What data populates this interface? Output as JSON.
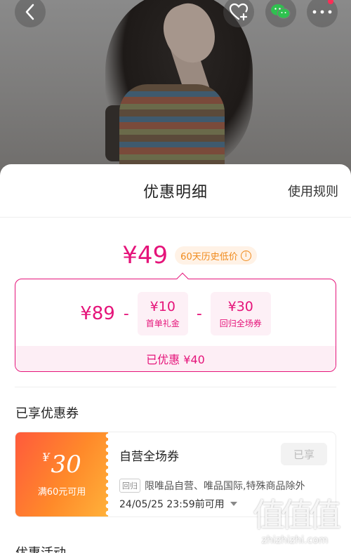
{
  "sheet": {
    "title": "优惠明细",
    "rules_label": "使用规则"
  },
  "price": {
    "final": "¥49",
    "low_badge": "60天历史低价"
  },
  "calculation": {
    "original": "¥89",
    "op1": "-",
    "op2": "-",
    "discounts": [
      {
        "amount": "¥10",
        "label": "首单礼金"
      },
      {
        "amount": "¥30",
        "label": "回归全场券"
      }
    ],
    "total_label": "已优惠 ¥40"
  },
  "coupons_section": {
    "title": "已享优惠券",
    "coupon": {
      "symbol": "¥",
      "amount": "30",
      "condition": "满60元可用",
      "name": "自营全场券",
      "status_label": "已享",
      "tag": "回归",
      "scope": "限唯品自营、唯品国际,特殊商品除外",
      "expiry": "24/05/25 23:59前可用"
    }
  },
  "activities_section": {
    "title": "优惠活动"
  },
  "watermark": {
    "big": "值值值",
    "small": "zhizhizhi.com"
  },
  "colors": {
    "accent": "#e5147a",
    "badge": "#f08a1c",
    "coupon_gradient_start": "#ff5a3c",
    "coupon_gradient_end": "#ffb23a"
  }
}
